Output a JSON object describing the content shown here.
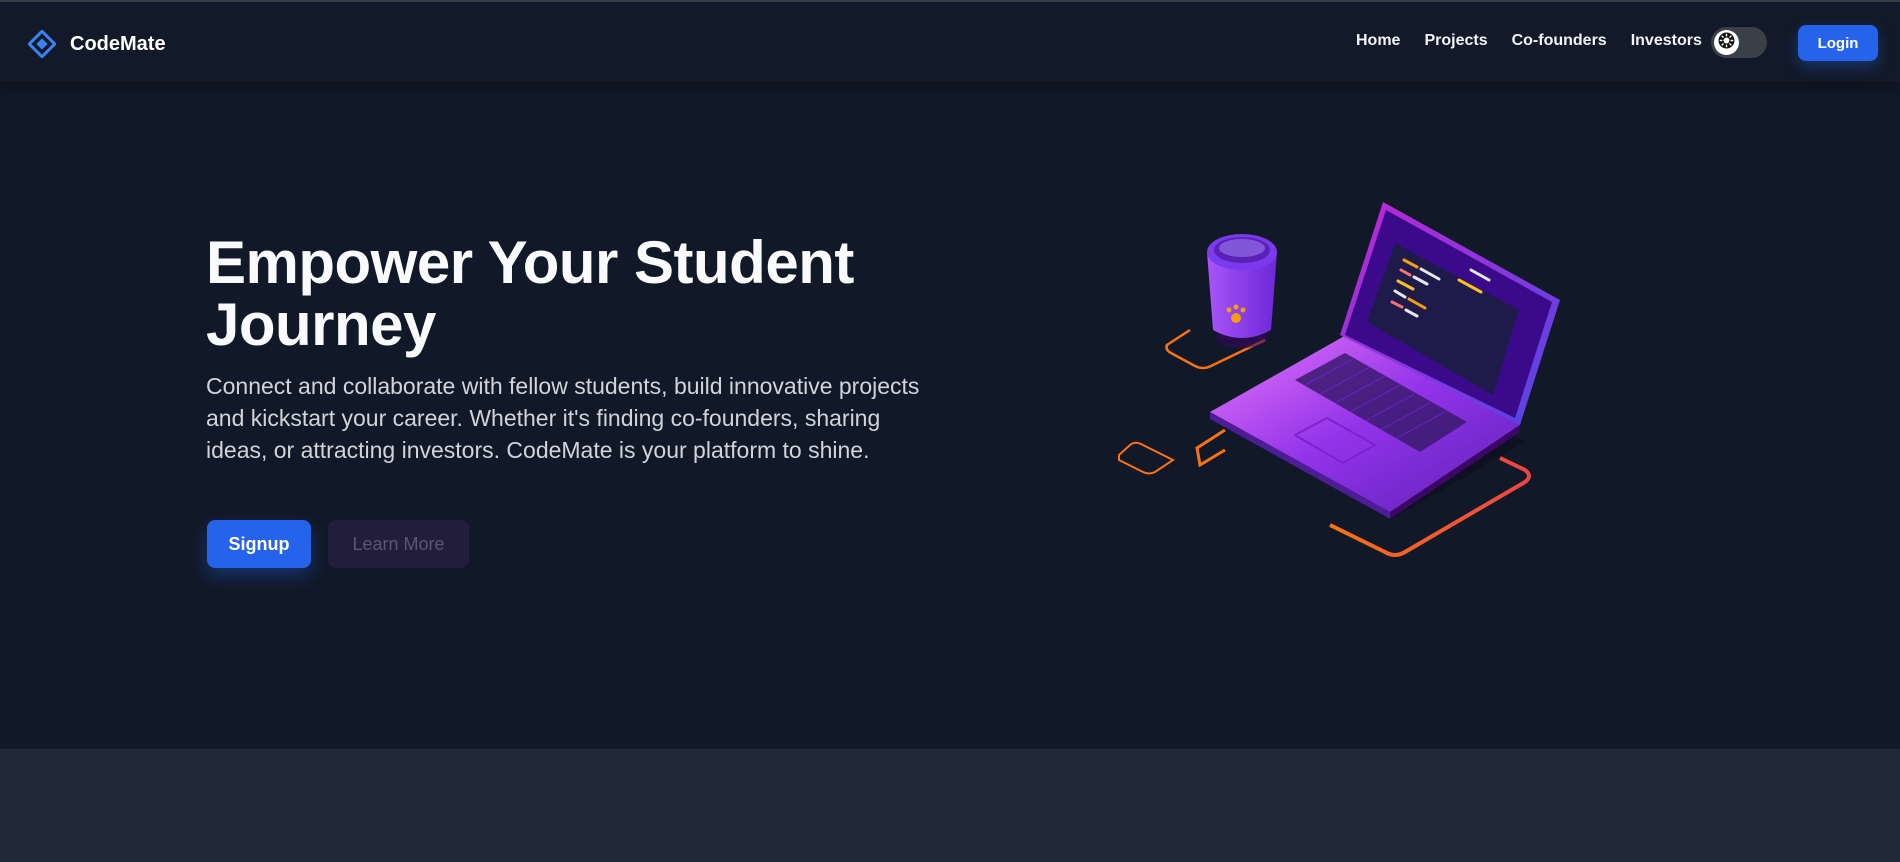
{
  "app": {
    "brand_name": "CodeMate",
    "brand_icon": "diamond-logo-icon"
  },
  "nav": {
    "links": [
      "Home",
      "Projects",
      "Co-founders",
      "Investors"
    ],
    "theme_toggle_icon": "sun-icon",
    "login_label": "Login"
  },
  "hero": {
    "title": "Empower Your Student Journey",
    "description": "Connect and collaborate with fellow students, build innovative projects and kickstart your career. Whether it's finding co-founders, sharing ideas, or attracting investors. CodeMate is your platform to shine.",
    "signup_label": "Signup",
    "learn_more_label": "Learn More",
    "illustration_icon": "laptop-coffee-illustration"
  },
  "colors": {
    "background": "#111827",
    "navbar": "#121a29",
    "primary": "#2563eb",
    "bottom_band": "#1f2937",
    "accent_purple": "#7c3aed",
    "accent_orange": "#f97316"
  }
}
